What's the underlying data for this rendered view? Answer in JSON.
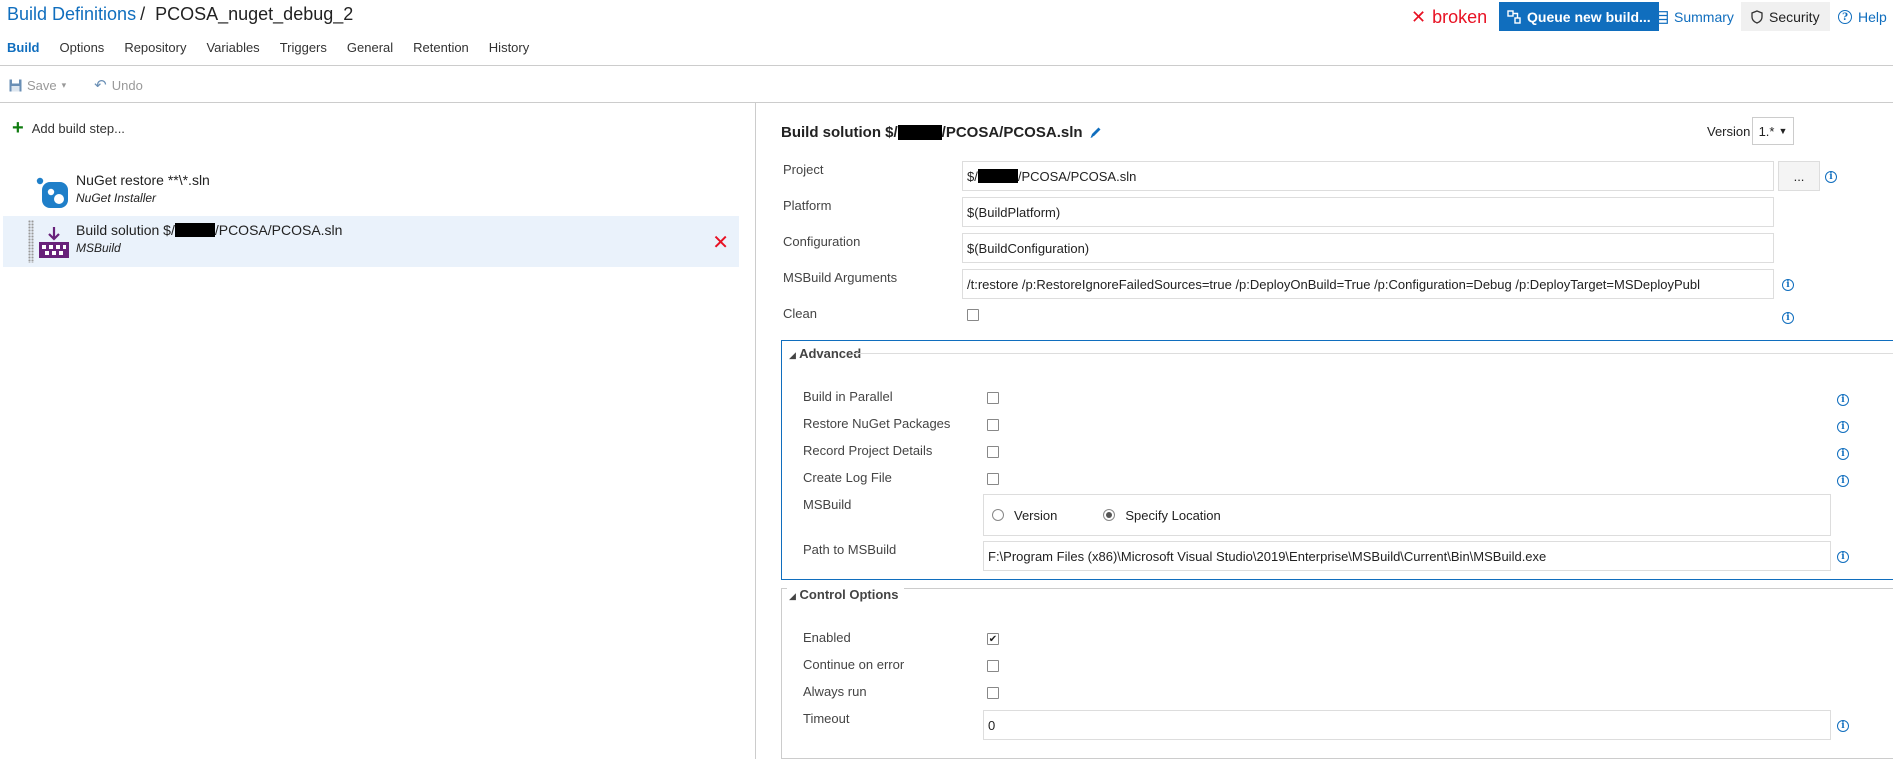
{
  "header": {
    "breadcrumb_root": "Build Definitions",
    "breadcrumb_sep": "/",
    "definition_name": "PCOSA_nuget_debug_2",
    "status": "broken",
    "queue_button": "Queue new build...",
    "summary_link": "Summary",
    "security_button": "Security",
    "help_link": "Help"
  },
  "tabs": [
    {
      "label": "Build",
      "active": true
    },
    {
      "label": "Options"
    },
    {
      "label": "Repository"
    },
    {
      "label": "Variables"
    },
    {
      "label": "Triggers"
    },
    {
      "label": "General"
    },
    {
      "label": "Retention"
    },
    {
      "label": "History"
    }
  ],
  "toolbar": {
    "save_label": "Save",
    "undo_label": "Undo"
  },
  "left_pane": {
    "add_step_label": "Add build step...",
    "steps": [
      {
        "title_prefix": "NuGet restore **\\*.sln",
        "subtitle": "NuGet Installer",
        "icon": "nuget-icon"
      },
      {
        "title_prefix": "Build solution $/",
        "title_suffix": "/PCOSA/PCOSA.sln",
        "subtitle": "MSBuild",
        "icon": "msbuild-icon",
        "selected": true
      }
    ]
  },
  "task": {
    "title_prefix": "Build solution $/",
    "title_suffix": "/PCOSA/PCOSA.sln",
    "version_label": "Version",
    "version_value": "1.*",
    "fields": {
      "project_label": "Project",
      "project_prefix": "$/",
      "project_suffix": "/PCOSA/PCOSA.sln",
      "browse_label": "...",
      "platform_label": "Platform",
      "platform_value": "$(BuildPlatform)",
      "configuration_label": "Configuration",
      "configuration_value": "$(BuildConfiguration)",
      "msbuild_args_label": "MSBuild Arguments",
      "msbuild_args_value": "/t:restore /p:RestoreIgnoreFailedSources=true /p:DeployOnBuild=True   /p:Configuration=Debug   /p:DeployTarget=MSDeployPubl",
      "clean_label": "Clean",
      "clean_checked": false
    },
    "advanced": {
      "legend": "Advanced",
      "build_in_parallel_label": "Build in Parallel",
      "restore_nuget_label": "Restore NuGet Packages",
      "record_project_details_label": "Record Project Details",
      "create_log_file_label": "Create Log File",
      "msbuild_label": "MSBuild",
      "msbuild_option_version": "Version",
      "msbuild_option_specify": "Specify Location",
      "msbuild_selected": "Specify Location",
      "path_label": "Path to MSBuild",
      "path_value": "F:\\Program Files (x86)\\Microsoft Visual Studio\\2019\\Enterprise\\MSBuild\\Current\\Bin\\MSBuild.exe"
    },
    "control_options": {
      "legend": "Control Options",
      "enabled_label": "Enabled",
      "enabled_checked": true,
      "continue_on_error_label": "Continue on error",
      "always_run_label": "Always run",
      "timeout_label": "Timeout",
      "timeout_value": "0"
    }
  },
  "colors": {
    "accent": "#106ebe",
    "error": "#e81123",
    "add_green": "#107c10",
    "msbuild_purple": "#68217a"
  }
}
